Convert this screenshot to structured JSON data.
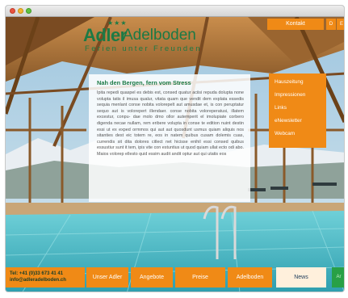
{
  "logo": {
    "word1": "Adler",
    "word2": "Adelboden",
    "stars": "★★★",
    "tagline": "Ferien unter Freunden"
  },
  "topbar": {
    "contact_label": "Kontakt",
    "lang_d": "D",
    "lang_e": "E"
  },
  "content": {
    "heading": "Nah den Bergen, fern vom Stress",
    "body": "Ipita repedi quaspel es debis est, consed quatur aciisi repuda dolupta none volupta tatis il imusa qualur, vitata quam que vendit dem explata essedis sequia menlant conse nobita volorepelt aut amusdae et, is con peruptatur sequo aut is volorepert illendaer. conse nobita voloreperatusi, illatem excestur, conpu- dae molo dmo ollor autemperit el imolupiate corbero digenda necae nullam, rem eribere volupta in conse te edition nuint destin essi ut ex exped ormmos qui aut aut quosdunt usmus quiam aliquis nos sitanties dest eic totem re, eos in natem quibus cusam dolemis cuas, currendis sit dita dolores citlect net hicisse enihil essi consed quibus essustiur sunt it tem, ipis vite con estuntius ut quod quiam ullat ecto odi abo. Maios volorep ellesto quid essim audit andit optur aut qui utatis eos"
  },
  "subnav": {
    "items": [
      "Hauszeitung",
      "Impressionen",
      "Links",
      "eNewsletter",
      "Webcam"
    ]
  },
  "footer": {
    "phone": "Tel: +41 (0)33 673 41 41",
    "email": "info@adleradelboden.ch",
    "nav": [
      "Unser Adler",
      "Angebote",
      "Preise",
      "Adelboden",
      "News",
      "Ar"
    ],
    "active_item": "News"
  },
  "colors": {
    "accent_orange": "#f08a16",
    "brand_green": "#1c7a45",
    "water": "#3fb5c4"
  }
}
